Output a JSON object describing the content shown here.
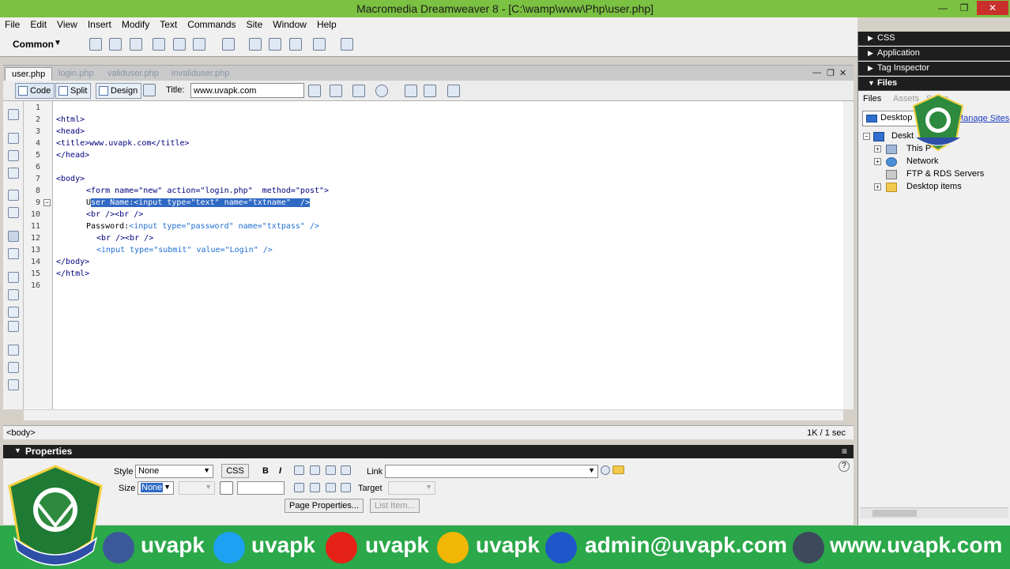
{
  "window": {
    "title": "Macromedia Dreamweaver 8 - [C:\\wamp\\www\\Php\\user.php]"
  },
  "menu": [
    "File",
    "Edit",
    "View",
    "Insert",
    "Modify",
    "Text",
    "Commands",
    "Site",
    "Window",
    "Help"
  ],
  "insert_bar": {
    "category": "Common"
  },
  "doc_tabs": [
    "user.php",
    "login.php",
    "validuser.php",
    "invaliduser.php"
  ],
  "doc_toolbar": {
    "code": "Code",
    "split": "Split",
    "design": "Design",
    "title_label": "Title:",
    "title_value": "www.uvapk.com"
  },
  "code": {
    "line_numbers": [
      "1",
      "2",
      "3",
      "4",
      "5",
      "6",
      "7",
      "8",
      "9",
      "10",
      "11",
      "12",
      "13",
      "14",
      "15",
      "16"
    ],
    "l2": "<html>",
    "l3": "<head>",
    "l4": "<title>www.uvapk.com</title>",
    "l5": "</head>",
    "l7": "<body>",
    "l8_a": "<form name=\"new\" action=\"login.php\"",
    "l8_b": "  method=\"post\">",
    "l9_pre": "U",
    "l9_sel": "ser Name:<input type=\"text\" name=\"txtname\"  />",
    "l10": "<br /><br />",
    "l11_a": "Password:",
    "l11_b": "<input type=\"password\"",
    "l11_c": " name=\"txtpass\"",
    "l11_d": " />",
    "l12": "<br /><br />",
    "l13_a": "<input type=\"submit\"",
    "l13_b": " value=\"Login\"",
    "l13_c": " />",
    "l14": "</body>",
    "l15": "</html>"
  },
  "status": {
    "tag_selector": "<body>",
    "size_time": "1K / 1 sec"
  },
  "properties": {
    "header": "Properties",
    "style_label": "Style",
    "style_value": "None",
    "css_button": "CSS",
    "bold": "B",
    "italic": "I",
    "link_label": "Link",
    "size_label": "Size",
    "size_value": "None",
    "target_label": "Target",
    "page_properties": "Page Properties...",
    "list_item": "List Item...",
    "help": "?"
  },
  "panels": {
    "css": "CSS",
    "application": "Application",
    "tag_inspector": "Tag Inspector",
    "files": "Files",
    "files_tabs": [
      "Files",
      "Assets",
      "Snipp"
    ],
    "site": "Desktop",
    "manage_sites": "Manage Sites",
    "tree": [
      "Deskt",
      "This P",
      "Network",
      "FTP & RDS Servers",
      "Desktop items"
    ]
  },
  "banner": {
    "facebook": "uvapk",
    "twitter": "uvapk",
    "youtube": "uvapk",
    "other": "uvapk",
    "email": "admin@uvapk.com",
    "web": "www.uvapk.com"
  },
  "colors": {
    "title_bar": "#7bc142",
    "banner": "#2ba84a",
    "selection": "#2f69c4",
    "panel_header": "#1e1e1e"
  }
}
